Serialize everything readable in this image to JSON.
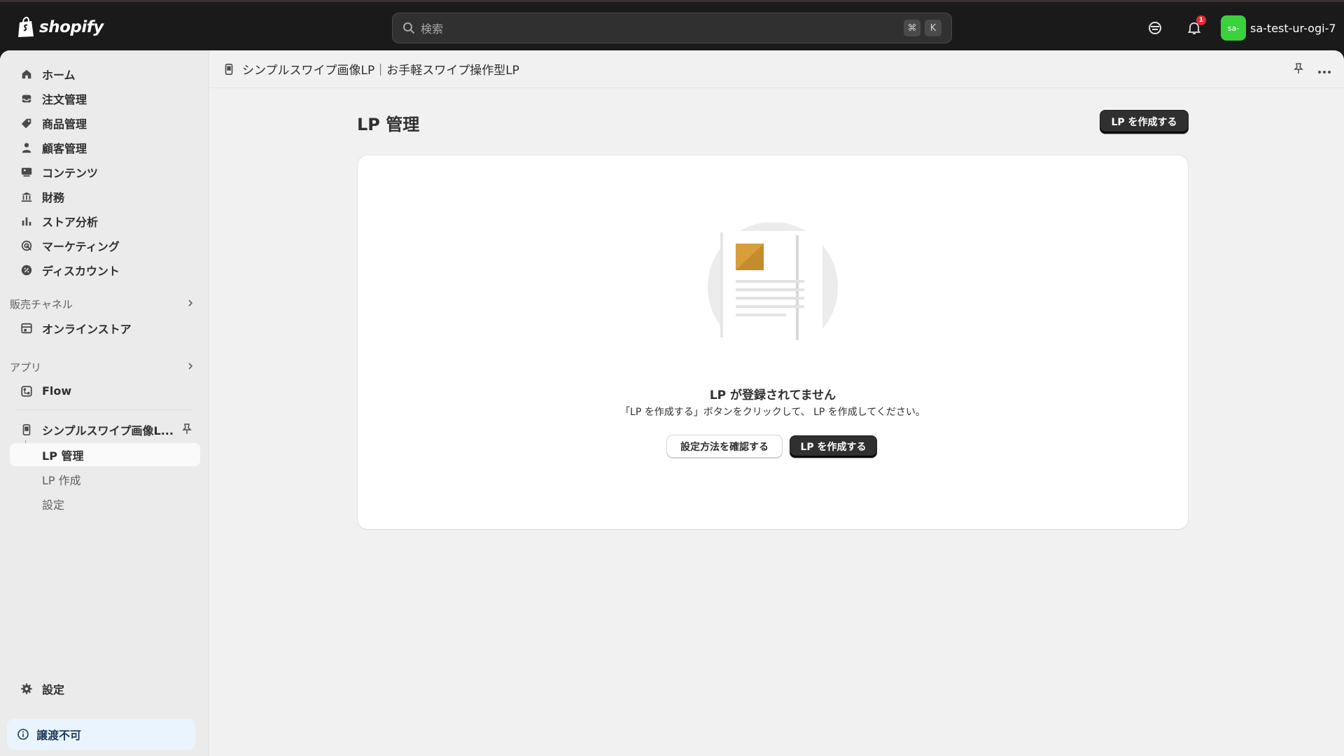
{
  "topbar": {
    "logo_text": "shopify",
    "search_placeholder": "検索",
    "shortcut_keys": [
      "⌘",
      "K"
    ],
    "notification_count": "1",
    "account_avatar": "sa-",
    "account_name": "sa-test-ur-ogi-7"
  },
  "sidebar": {
    "items": [
      {
        "label": "ホーム",
        "icon": "home-icon"
      },
      {
        "label": "注文管理",
        "icon": "inbox-icon"
      },
      {
        "label": "商品管理",
        "icon": "tag-icon"
      },
      {
        "label": "顧客管理",
        "icon": "person-icon"
      },
      {
        "label": "コンテンツ",
        "icon": "image-icon"
      },
      {
        "label": "財務",
        "icon": "bank-icon"
      },
      {
        "label": "ストア分析",
        "icon": "bar-chart-icon"
      },
      {
        "label": "マーケティング",
        "icon": "target-icon"
      },
      {
        "label": "ディスカウント",
        "icon": "discount-icon"
      }
    ],
    "sales_channel_label": "販売チャネル",
    "online_store_label": "オンラインストア",
    "apps_label": "アプリ",
    "flow_label": "Flow",
    "app_name": "シンプルスワイプ画像L...",
    "app_sub_items": [
      "LP 管理",
      "LP 作成",
      "設定"
    ],
    "settings_label": "設定",
    "notice_label": "譲渡不可"
  },
  "header": {
    "app_title": "シンプルスワイプ画像LP｜お手軽スワイプ操作型LP"
  },
  "main": {
    "page_title": "LP 管理",
    "create_button": "LP を作成する",
    "empty_title": "LP が登録されてません",
    "empty_desc": "「LP を作成する」ボタンをクリックして、 LP を作成してください。",
    "secondary_button": "設定方法を確認する",
    "primary_button": "LP を作成する"
  }
}
